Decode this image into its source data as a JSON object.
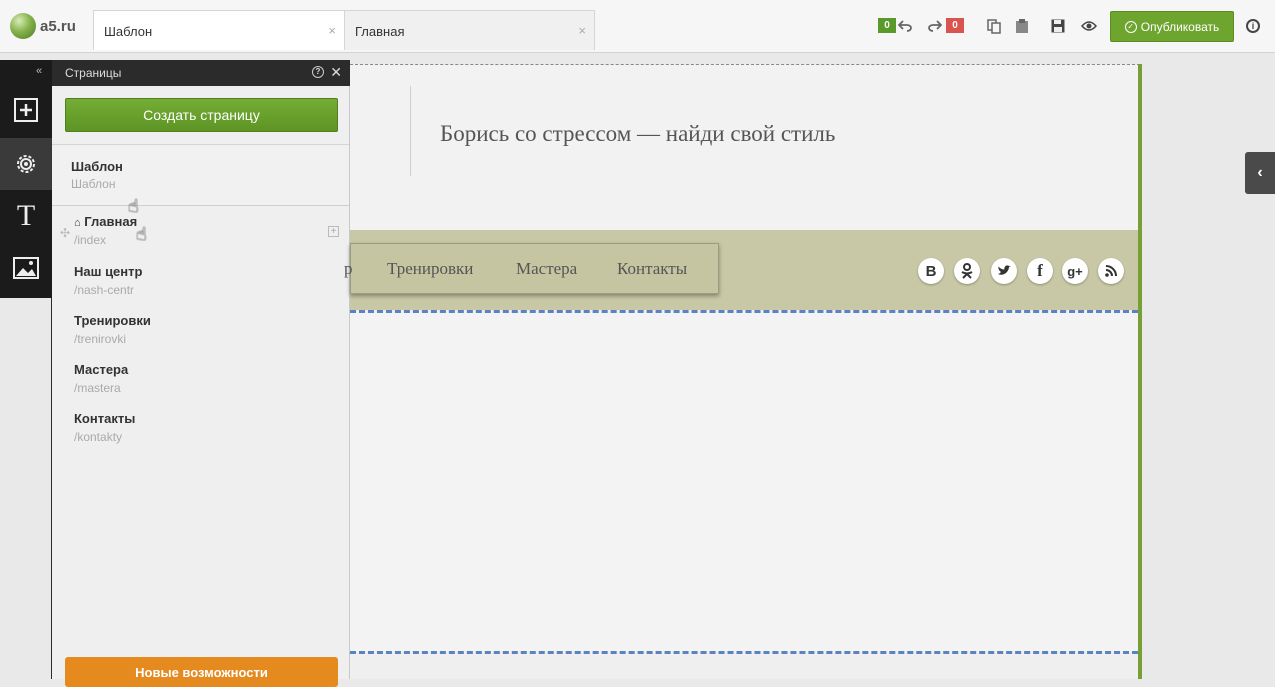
{
  "app": {
    "logo_text": "a5.ru"
  },
  "tabs": [
    {
      "label": "Шаблон",
      "close": "×"
    },
    {
      "label": "Главная",
      "close": "×"
    }
  ],
  "toolbar": {
    "undo_count": "0",
    "redo_count": "0",
    "undo_color": "#5a9a2a",
    "redo_color": "#d9534f",
    "publish_label": "Опубликовать"
  },
  "panel": {
    "collapse_glyph": "«",
    "title": "Страницы",
    "create_label": "Создать страницу",
    "template": {
      "name": "Шаблон",
      "url": "Шаблон"
    },
    "pages": [
      {
        "name": "Главная",
        "url": "/index",
        "home": true
      },
      {
        "name": "Наш центр",
        "url": "/nash-centr"
      },
      {
        "name": "Тренировки",
        "url": "/trenirovki"
      },
      {
        "name": "Мастера",
        "url": "/mastera"
      },
      {
        "name": "Контакты",
        "url": "/kontakty"
      }
    ],
    "new_features_label": "Новые возможности"
  },
  "site": {
    "slogan": "Борись со стрессом — найди свой стиль",
    "menu_partial": "р",
    "menu": [
      "Тренировки",
      "Мастера",
      "Контакты"
    ],
    "social": [
      "vk",
      "odnoklassniki",
      "twitter",
      "facebook",
      "google-plus",
      "rss"
    ],
    "social_glyphs": {
      "vk": "В",
      "facebook": "f",
      "google_plus": "g+"
    }
  },
  "colors": {
    "accent_green": "#6ea52f",
    "orange": "#e58a1f",
    "nav_band": "#c8c8a6"
  }
}
